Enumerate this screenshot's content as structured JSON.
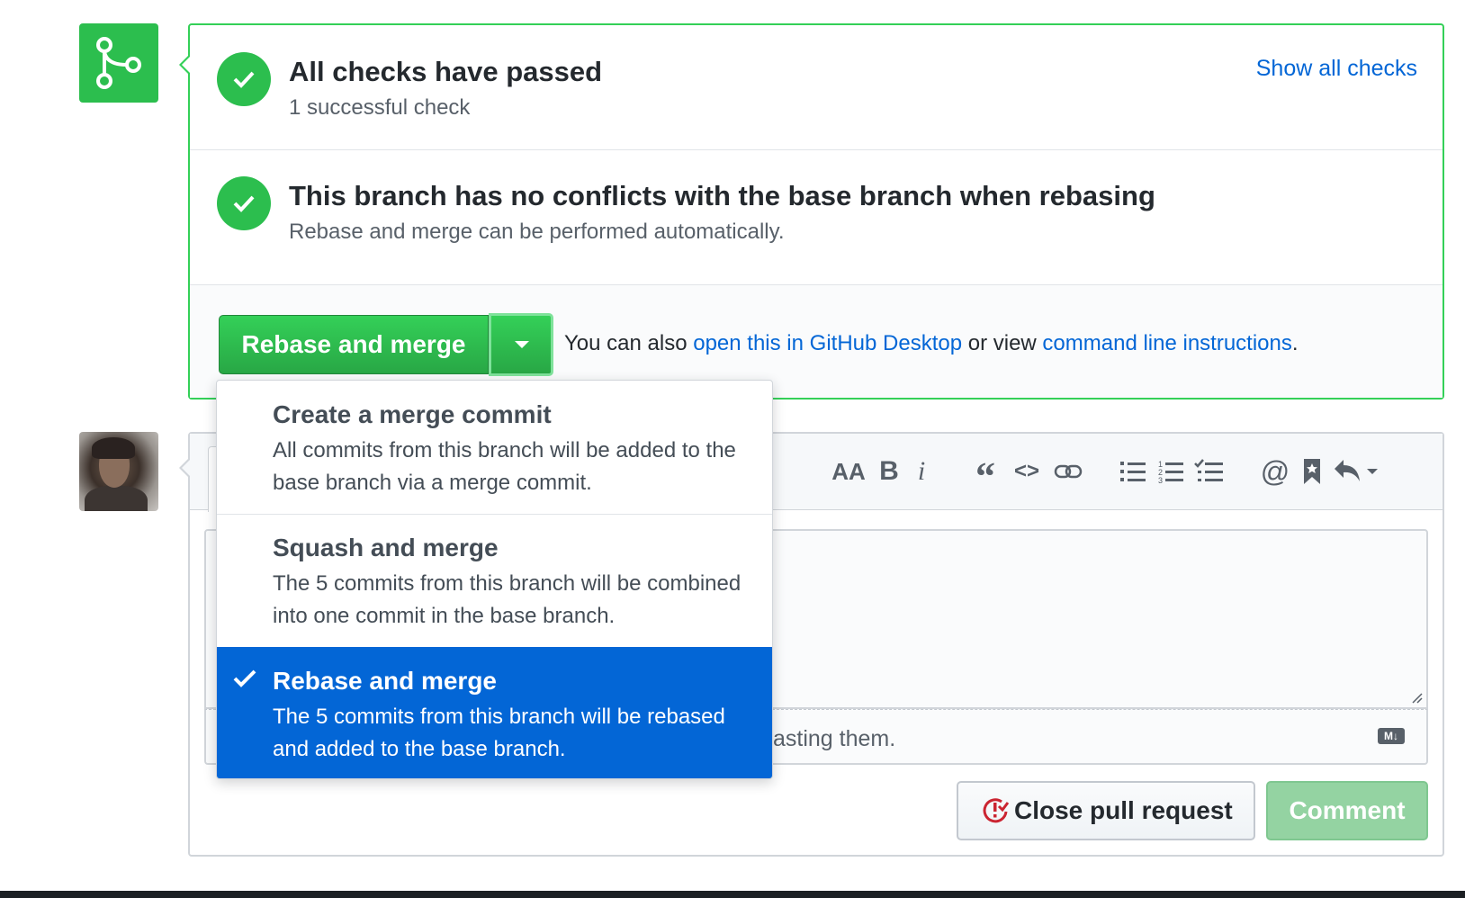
{
  "checks": {
    "title": "All checks have passed",
    "subtitle": "1 successful check",
    "show_all_link": "Show all checks"
  },
  "conflicts": {
    "title": "This branch has no conflicts with the base branch when rebasing",
    "subtitle": "Rebase and merge can be performed automatically."
  },
  "merge_actions": {
    "button_label": "Rebase and merge",
    "also_prefix": "You can also ",
    "desktop_link": "open this in GitHub Desktop",
    "or_view": " or view ",
    "cli_link": "command line instructions",
    "period": "."
  },
  "merge_menu": {
    "items": [
      {
        "title": "Create a merge commit",
        "description": "All commits from this branch will be added to the base branch via a merge commit.",
        "selected": false
      },
      {
        "title": "Squash and merge",
        "description": "The 5 commits from this branch will be combined into one commit in the base branch.",
        "selected": false
      },
      {
        "title": "Rebase and merge",
        "description": "The 5 commits from this branch will be rebased and added to the base branch.",
        "selected": true
      }
    ]
  },
  "comment": {
    "toolbar_icons": [
      "text-size-icon",
      "bold-icon",
      "italic-icon",
      "quote-icon",
      "code-icon",
      "link-icon",
      "unordered-list-icon",
      "ordered-list-icon",
      "task-list-icon",
      "mention-icon",
      "saved-reply-icon",
      "reply-icon"
    ],
    "drop_hint_visible": "asting them.",
    "markdown_badge": "M↓",
    "close_button": "Close pull request",
    "comment_button": "Comment"
  },
  "colors": {
    "green": "#2cbe4e",
    "link_blue": "#0366d6",
    "selected_blue": "#0366d6",
    "danger_red": "#cb2431"
  }
}
